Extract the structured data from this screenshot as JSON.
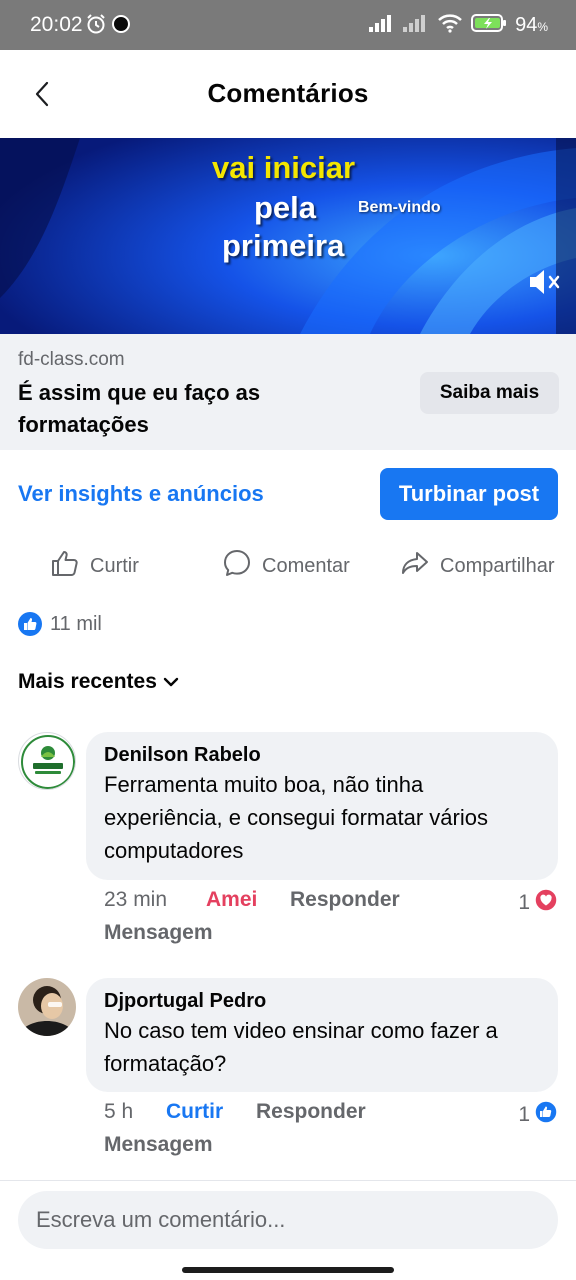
{
  "status_bar": {
    "time": "20:02",
    "battery_percent": "94",
    "battery_unit": "%"
  },
  "header": {
    "title": "Comentários"
  },
  "video": {
    "caption_lines": [
      "vai iniciar",
      "pela",
      "primeira"
    ],
    "watermark": "Bem-vindo"
  },
  "ad": {
    "domain": "fd-class.com",
    "headline": "É assim que eu faço as formatações",
    "cta_label": "Saiba mais"
  },
  "insights": {
    "link_label": "Ver insights e anúncios",
    "boost_label": "Turbinar post"
  },
  "actions": {
    "like": "Curtir",
    "comment": "Comentar",
    "share": "Compartilhar"
  },
  "reactions": {
    "count": "11 mil"
  },
  "sort": {
    "label": "Mais recentes"
  },
  "comments": [
    {
      "author": "Denilson Rabelo",
      "text": "Ferramenta muito boa, não tinha experiência, e consegui formatar vários computadores",
      "time": "23 min",
      "reaction_label": "Amei",
      "reply_label": "Responder",
      "message_label": "Mensagem",
      "reaction_count": "1",
      "reaction_type": "love-icon"
    },
    {
      "author": "Djportugal Pedro",
      "text": "No caso tem video ensinar como fazer a formatação?",
      "time": "5 h",
      "reaction_label": "Curtir",
      "reply_label": "Responder",
      "message_label": "Mensagem",
      "reaction_count": "1",
      "reaction_type": "like-icon"
    }
  ],
  "composer": {
    "placeholder": "Escreva um comentário..."
  },
  "colors": {
    "accent": "#1877f2",
    "love": "#e4405f",
    "muted": "#65676b",
    "bubble": "#f0f2f5"
  }
}
